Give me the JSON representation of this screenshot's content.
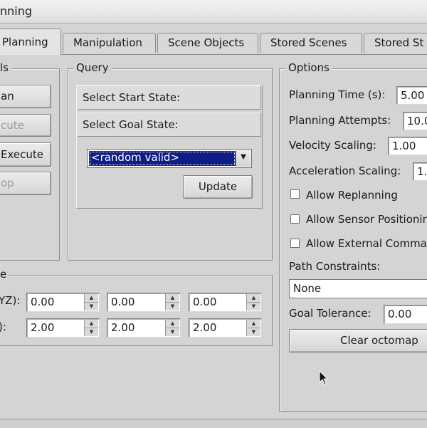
{
  "window": {
    "title": "nning"
  },
  "tabs": [
    {
      "label": "Planning",
      "active": true
    },
    {
      "label": "Manipulation",
      "active": false
    },
    {
      "label": "Scene Objects",
      "active": false
    },
    {
      "label": "Stored Scenes",
      "active": false
    },
    {
      "label": "Stored St",
      "active": false
    }
  ],
  "commands": {
    "title": "ls",
    "buttons": [
      {
        "label": "an",
        "enabled": true
      },
      {
        "label": "cute",
        "enabled": false
      },
      {
        "label": "Execute",
        "enabled": true
      },
      {
        "label": "op",
        "enabled": false
      }
    ]
  },
  "query": {
    "title": "Query",
    "start_state_label": "Select Start State:",
    "goal_state_label": "Select Goal State:",
    "goal_state_selected": "<random valid>",
    "update_button": "Update"
  },
  "workspace": {
    "title": "e",
    "center_label": "YZ):",
    "size_label": "):",
    "center": [
      "0.00",
      "0.00",
      "0.00"
    ],
    "size": [
      "2.00",
      "2.00",
      "2.00"
    ]
  },
  "options": {
    "title": "Options",
    "planning_time_label": "Planning Time (s):",
    "planning_time": "5.00",
    "planning_attempts_label": "Planning Attempts:",
    "planning_attempts": "10.0",
    "velocity_scaling_label": "Velocity Scaling:",
    "velocity_scaling": "1.00",
    "acceleration_scaling_label": "Acceleration Scaling:",
    "acceleration_scaling": "1.",
    "allow_replanning_label": "Allow Replanning",
    "allow_replanning": false,
    "allow_sensor_label": "Allow Sensor Positionin",
    "allow_sensor": false,
    "allow_external_label": "Allow External Comma",
    "allow_external": false,
    "path_constraints_label": "Path Constraints:",
    "path_constraints": "None",
    "goal_tolerance_label": "Goal Tolerance:",
    "goal_tolerance": "0.00",
    "clear_octomap_button": "Clear octomap"
  }
}
